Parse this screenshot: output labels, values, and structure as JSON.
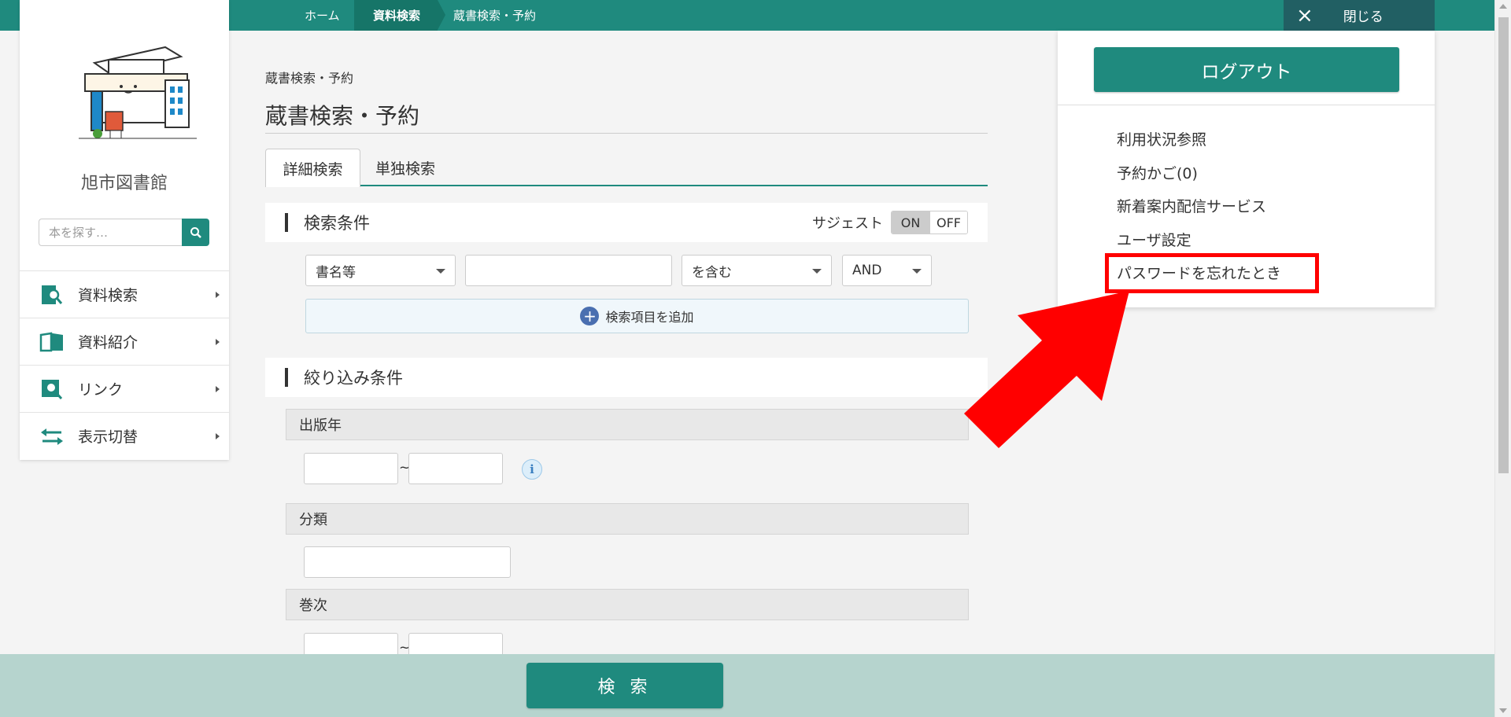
{
  "topbar": {
    "breadcrumbs": [
      "ホーム",
      "資料検索",
      "蔵書検索・予約"
    ],
    "close_label": "閉じる"
  },
  "sidebar": {
    "library_name": "旭市図書館",
    "search_placeholder": "本を探す…",
    "items": [
      {
        "label": "資料検索",
        "icon": "search-book-icon"
      },
      {
        "label": "資料紹介",
        "icon": "open-book-icon"
      },
      {
        "label": "リンク",
        "icon": "link-search-icon"
      },
      {
        "label": "表示切替",
        "icon": "swap-arrows-icon"
      }
    ]
  },
  "main": {
    "breadcrumb": "蔵書検索・予約",
    "title": "蔵書検索・予約",
    "tabs": [
      "詳細検索",
      "単独検索"
    ],
    "search_conditions": {
      "heading": "検索条件",
      "suggest_label": "サジェスト",
      "suggest_on": "ON",
      "suggest_off": "OFF",
      "field_select": "書名等",
      "match_select": "を含む",
      "logic_select": "AND",
      "add_item_label": "検索項目を追加"
    },
    "filter_conditions": {
      "heading": "絞り込み条件",
      "publication_year": "出版年",
      "range_separator": "~",
      "classification": "分類",
      "volume": "巻次"
    },
    "search_button": "検 索"
  },
  "user_menu": {
    "logout_label": "ログアウト",
    "links": [
      "利用状況参照",
      "予約かご(0)",
      "新着案内配信サービス",
      "ユーザ設定",
      "パスワードを忘れたとき"
    ]
  },
  "colors": {
    "brand_teal": "#1f8a7e",
    "highlight_red": "#ff0000",
    "bottom_bar": "#b6d4ce"
  }
}
